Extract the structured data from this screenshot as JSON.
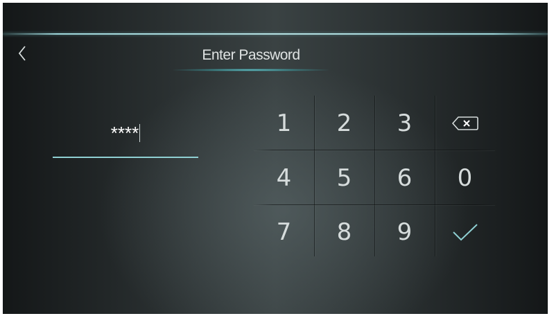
{
  "header": {
    "title": "Enter Password",
    "back_icon": "chevron-left-icon"
  },
  "password": {
    "masked_value": "****"
  },
  "keypad": {
    "keys": [
      "1",
      "2",
      "3",
      "backspace",
      "4",
      "5",
      "6",
      "0",
      "7",
      "8",
      "9",
      "confirm"
    ],
    "labels": {
      "k1": "1",
      "k2": "2",
      "k3": "3",
      "k4": "4",
      "k5": "5",
      "k6": "6",
      "k0": "0",
      "k7": "7",
      "k8": "8",
      "k9": "9"
    },
    "backspace_icon": "backspace-icon",
    "confirm_icon": "checkmark-icon"
  },
  "colors": {
    "accent": "#8fd0d3",
    "text": "#d6dcdc",
    "background": "#2a3031"
  }
}
